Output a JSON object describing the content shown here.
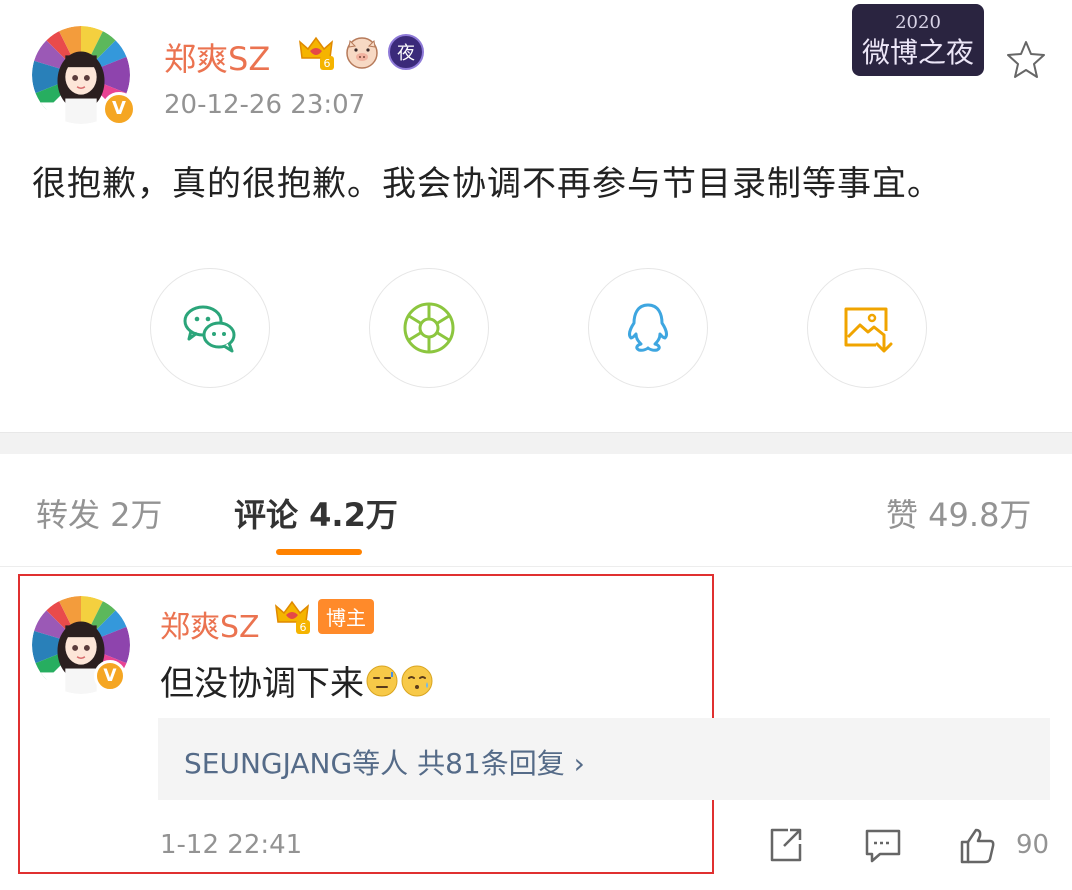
{
  "post": {
    "username": "郑爽SZ",
    "vip_level": "6",
    "night_badge": "夜",
    "verified_mark": "V",
    "timestamp": "20-12-26 23:07",
    "event_logo_year": "2020",
    "event_logo_text": "微博之夜",
    "text": "很抱歉，真的很抱歉。我会协调不再参与节目录制等事宜。"
  },
  "share": {
    "icons": [
      "wechat-icon",
      "moments-icon",
      "qq-icon",
      "save-image-icon"
    ]
  },
  "tabs": [
    {
      "label": "转发 2万"
    },
    {
      "label": "评论 4.2万"
    },
    {
      "label": "赞 49.8万"
    }
  ],
  "comment": {
    "username": "郑爽SZ",
    "vip_level": "6",
    "host_tag": "博主",
    "verified_mark": "V",
    "text": "但没协调下来",
    "replies_summary": "SEUNGJANG等人  共81条回复 ›",
    "timestamp": "1-12 22:41",
    "like_count": "90"
  },
  "colors": {
    "username": "#eb7350",
    "accent": "#ff8200",
    "highlight": "#e03030",
    "reply_link": "#556b88"
  }
}
